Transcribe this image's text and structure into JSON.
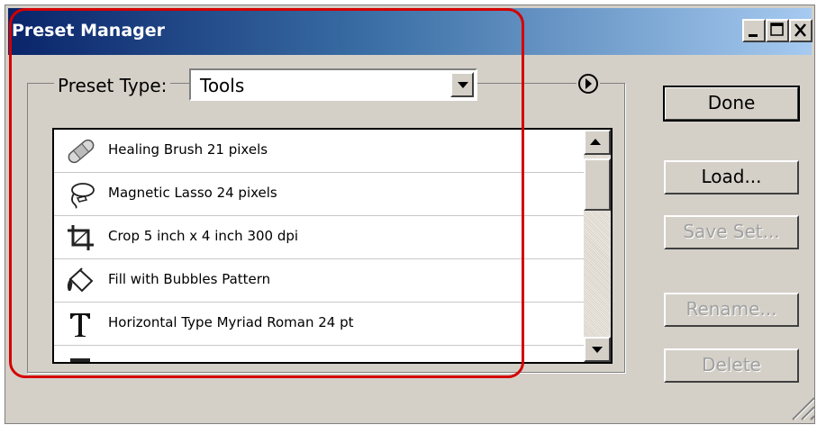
{
  "window": {
    "title": "Preset Manager",
    "controls": [
      "minimize",
      "maximize",
      "close"
    ]
  },
  "preset_type": {
    "label": "Preset Type:",
    "value": "Tools"
  },
  "list": {
    "items": [
      {
        "label": "Healing Brush 21 pixels",
        "icon": "healing-brush-icon"
      },
      {
        "label": "Magnetic Lasso 24 pixels",
        "icon": "magnetic-lasso-icon"
      },
      {
        "label": "Crop 5 inch x 4 inch 300 dpi",
        "icon": "crop-icon"
      },
      {
        "label": "Fill with Bubbles Pattern",
        "icon": "paint-bucket-icon"
      },
      {
        "label": "Horizontal Type Myriad Roman 24 pt",
        "icon": "type-tool-icon"
      }
    ]
  },
  "buttons": {
    "done": "Done",
    "load": "Load...",
    "save_set": "Save Set...",
    "rename": "Rename...",
    "delete": "Delete"
  },
  "colors": {
    "highlight": "#d40000",
    "title_bar_start": "#0a246a",
    "title_bar_end": "#a6caf0"
  }
}
